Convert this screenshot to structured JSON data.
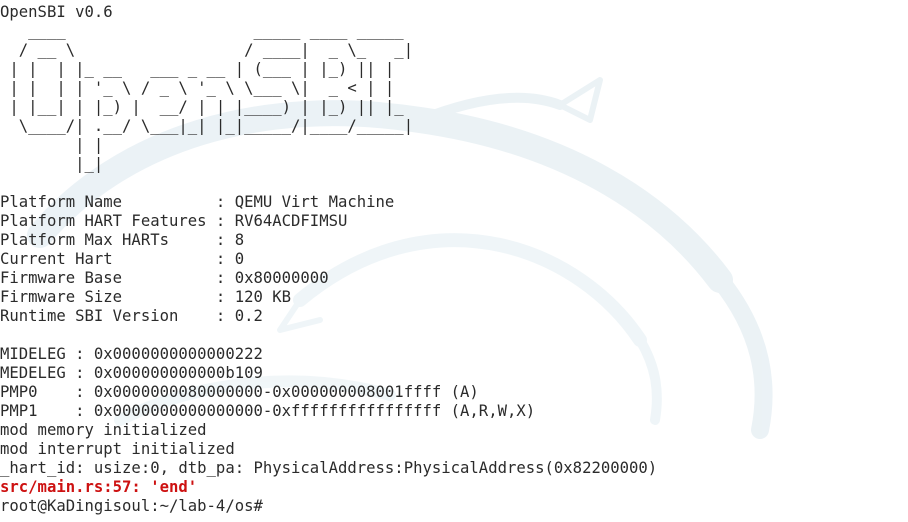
{
  "terminal": {
    "lines": [
      {
        "text": "OpenSBI v0.6",
        "style": "normal"
      },
      {
        "text": "   ____                    _____ ____ _____",
        "style": "normal"
      },
      {
        "text": "  / __ \\                  / ____|  _ \\_   _|",
        "style": "normal"
      },
      {
        "text": " | |  | |_ __   ___ _ __ | (___ | |_) || |",
        "style": "normal"
      },
      {
        "text": " | |  | | '_ \\ / _ \\ '_ \\ \\___ \\|  _ < | |",
        "style": "normal"
      },
      {
        "text": " | |__| | |_) |  __/ | | |____) | |_) || |_",
        "style": "normal"
      },
      {
        "text": "  \\____/| .__/ \\___|_| |_|_____/|____/_____|",
        "style": "normal"
      },
      {
        "text": "        | |",
        "style": "normal"
      },
      {
        "text": "        |_|",
        "style": "normal"
      },
      {
        "text": "",
        "style": "normal"
      },
      {
        "text": "Platform Name          : QEMU Virt Machine",
        "style": "normal"
      },
      {
        "text": "Platform HART Features : RV64ACDFIMSU",
        "style": "normal"
      },
      {
        "text": "Platform Max HARTs     : 8",
        "style": "normal"
      },
      {
        "text": "Current Hart           : 0",
        "style": "normal"
      },
      {
        "text": "Firmware Base          : 0x80000000",
        "style": "normal"
      },
      {
        "text": "Firmware Size          : 120 KB",
        "style": "normal"
      },
      {
        "text": "Runtime SBI Version    : 0.2",
        "style": "normal"
      },
      {
        "text": "",
        "style": "normal"
      },
      {
        "text": "MIDELEG : 0x0000000000000222",
        "style": "normal"
      },
      {
        "text": "MEDELEG : 0x000000000000b109",
        "style": "normal"
      },
      {
        "text": "PMP0    : 0x0000000080000000-0x000000008001ffff (A)",
        "style": "normal"
      },
      {
        "text": "PMP1    : 0x0000000000000000-0xffffffffffffffff (A,R,W,X)",
        "style": "normal"
      },
      {
        "text": "mod memory initialized",
        "style": "normal"
      },
      {
        "text": "mod interrupt initialized",
        "style": "normal"
      },
      {
        "text": "_hart_id: usize:0, dtb_pa: PhysicalAddress:PhysicalAddress(0x82200000)",
        "style": "normal"
      },
      {
        "text": "src/main.rs:57: 'end'",
        "style": "err"
      },
      {
        "text": "root@KaDingisoul:~/lab-4/os#",
        "style": "normal"
      }
    ]
  },
  "colors": {
    "background": "#ffffff",
    "text": "#2b2b2b",
    "error_text": "#cd1111",
    "watermark": "#e4eef2"
  },
  "watermark_icon": "kali-dragon-icon"
}
